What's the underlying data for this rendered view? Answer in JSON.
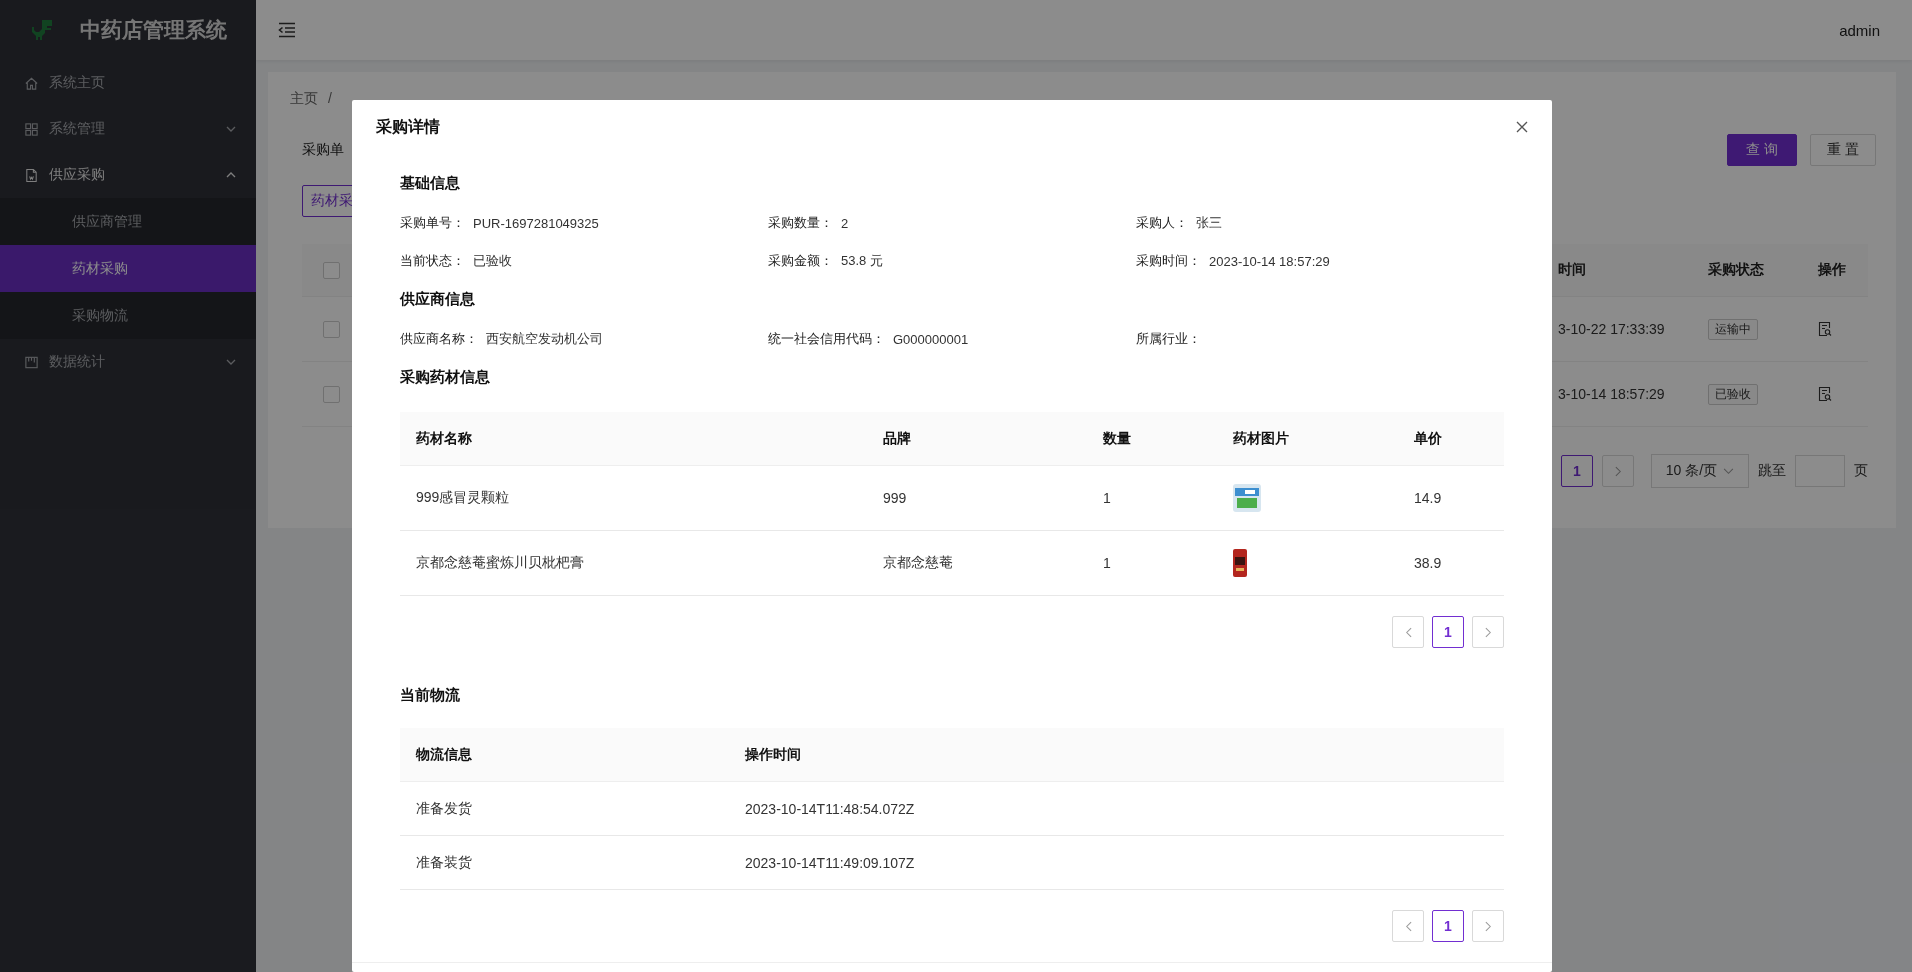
{
  "sidebar": {
    "title": "中药店管理系统",
    "items": [
      {
        "label": "系统主页",
        "kind": "link"
      },
      {
        "label": "系统管理",
        "kind": "group",
        "expanded": false
      },
      {
        "label": "供应采购",
        "kind": "group",
        "expanded": true,
        "children": [
          {
            "label": "供应商管理",
            "selected": false
          },
          {
            "label": "药材采购",
            "selected": true
          },
          {
            "label": "采购物流",
            "selected": false
          }
        ]
      },
      {
        "label": "数据统计",
        "kind": "group",
        "expanded": false
      }
    ]
  },
  "header": {
    "user": "admin"
  },
  "breadcrumb": {
    "items": [
      "主页"
    ],
    "separator": "/"
  },
  "filter": {
    "label": "采购单",
    "buttons": [
      {
        "label": "查 询",
        "kind": "primary"
      },
      {
        "label": "重 置",
        "kind": "default"
      }
    ]
  },
  "toolbar": {
    "button": "药材采"
  },
  "table": {
    "all_selected": false,
    "columns": [
      "时间",
      "采购状态",
      "操作"
    ],
    "rows": [
      {
        "selected": false,
        "time": "3-10-22 17:33:39",
        "status": "运输中"
      },
      {
        "selected": false,
        "time": "3-10-14 18:57:29",
        "status": "已验收"
      }
    ]
  },
  "pagination": {
    "pages": [
      {
        "label": "1",
        "selected": true
      }
    ],
    "page_size": "10 条/页",
    "jump_label": "跳至",
    "page_suffix": "页"
  },
  "modal": {
    "title": "采购详情",
    "basic": {
      "title": "基础信息",
      "items": [
        {
          "label": "采购单号：",
          "value": "PUR-1697281049325"
        },
        {
          "label": "采购数量：",
          "value": "2"
        },
        {
          "label": "采购人：",
          "value": "张三"
        },
        {
          "label": "当前状态：",
          "value": "已验收"
        },
        {
          "label": "采购金额：",
          "value": "53.8 元"
        },
        {
          "label": "采购时间：",
          "value": "2023-10-14 18:57:29"
        }
      ]
    },
    "supplier": {
      "title": "供应商信息",
      "items": [
        {
          "label": "供应商名称：",
          "value": "西安航空发动机公司"
        },
        {
          "label": "统一社会信用代码：",
          "value": "G000000001"
        },
        {
          "label": "所属行业："
        }
      ]
    },
    "medicines": {
      "title": "采购药材信息",
      "columns": [
        "药材名称",
        "品牌",
        "数量",
        "药材图片",
        "单价"
      ],
      "rows": [
        {
          "name": "999感冒灵颗粒",
          "brand": "999",
          "quantity": "1",
          "price": "14.9"
        },
        {
          "name": "京都念慈菴蜜炼川贝枇杷膏",
          "brand": "京都念慈菴",
          "quantity": "1",
          "price": "38.9"
        }
      ],
      "pages": [
        {
          "label": "1",
          "selected": true
        }
      ]
    },
    "logistics": {
      "title": "当前物流",
      "columns": [
        "物流信息",
        "操作时间"
      ],
      "rows": [
        {
          "info": "准备发货",
          "time": "2023-10-14T11:48:54.072Z"
        },
        {
          "info": "准备装货",
          "time": "2023-10-14T11:49:09.107Z"
        }
      ],
      "pages": [
        {
          "label": "1",
          "selected": true
        }
      ]
    }
  }
}
